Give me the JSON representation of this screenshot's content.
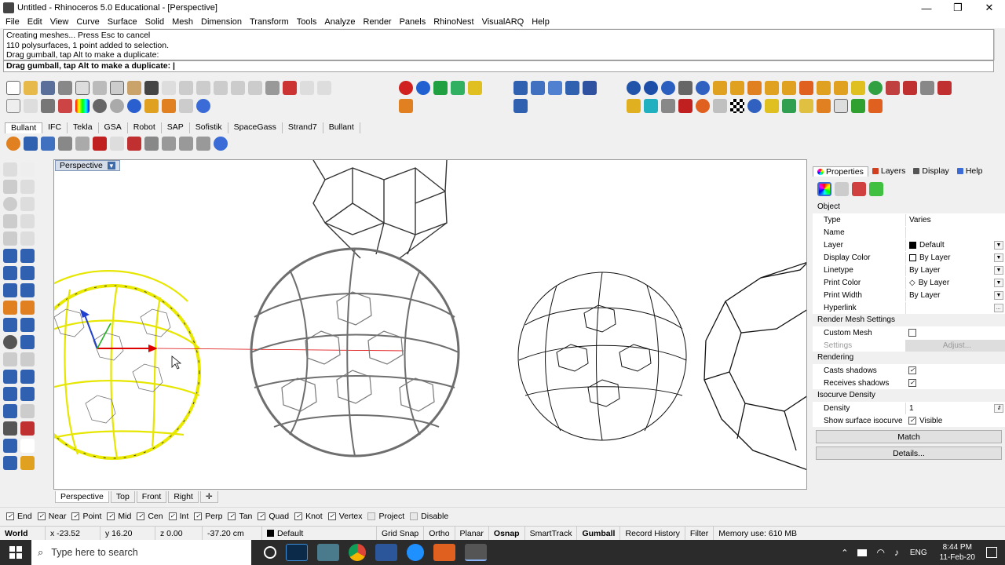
{
  "window": {
    "title": "Untitled - Rhinoceros 5.0 Educational - [Perspective]",
    "min": "—",
    "max": "❐",
    "close": "✕"
  },
  "menu": [
    "File",
    "Edit",
    "View",
    "Curve",
    "Surface",
    "Solid",
    "Mesh",
    "Dimension",
    "Transform",
    "Tools",
    "Analyze",
    "Render",
    "Panels",
    "RhinoNest",
    "VisualARQ",
    "Help"
  ],
  "command": {
    "history": [
      "Creating meshes... Press Esc to cancel",
      "110 polysurfaces, 1 point added to selection.",
      "Drag gumball, tap Alt to make a duplicate:"
    ],
    "prompt": "Drag gumball, tap Alt to make a duplicate:"
  },
  "toolbar_tabs": [
    "Bullant",
    "IFC",
    "Tekla",
    "GSA",
    "Robot",
    "SAP",
    "Sofistik",
    "SpaceGass",
    "Strand7",
    "Bullant"
  ],
  "viewport": {
    "label": "Perspective",
    "tabs": [
      "Perspective",
      "Top",
      "Front",
      "Right"
    ],
    "add": "✛"
  },
  "panel": {
    "tabs": [
      "Properties",
      "Layers",
      "Display",
      "Help"
    ],
    "sections": {
      "object": "Object",
      "render_mesh": "Render Mesh Settings",
      "rendering": "Rendering",
      "isocurve": "Isocurve Density"
    },
    "rows": [
      {
        "k": "Type",
        "v": "Varies"
      },
      {
        "k": "Name",
        "v": ""
      },
      {
        "k": "Layer",
        "v": "Default"
      },
      {
        "k": "Display Color",
        "v": "By Layer"
      },
      {
        "k": "Linetype",
        "v": "By Layer"
      },
      {
        "k": "Print Color",
        "v": "By Layer"
      },
      {
        "k": "Print Width",
        "v": "By Layer"
      },
      {
        "k": "Hyperlink",
        "v": ""
      }
    ],
    "custom_mesh": "Custom Mesh",
    "settings": "Settings",
    "adjust": "Adjust...",
    "casts": "Casts shadows",
    "receives": "Receives shadows",
    "density": "Density",
    "density_val": "1",
    "show_iso": "Show surface isocurve",
    "visible": "Visible",
    "match": "Match",
    "details": "Details..."
  },
  "osnap": [
    {
      "label": "End",
      "on": true
    },
    {
      "label": "Near",
      "on": true
    },
    {
      "label": "Point",
      "on": true
    },
    {
      "label": "Mid",
      "on": true
    },
    {
      "label": "Cen",
      "on": true
    },
    {
      "label": "Int",
      "on": true
    },
    {
      "label": "Perp",
      "on": true
    },
    {
      "label": "Tan",
      "on": true
    },
    {
      "label": "Quad",
      "on": true
    },
    {
      "label": "Knot",
      "on": true
    },
    {
      "label": "Vertex",
      "on": true
    },
    {
      "label": "Project",
      "on": false
    },
    {
      "label": "Disable",
      "on": false
    }
  ],
  "status": {
    "cplane": "World",
    "x": "x -23.52",
    "y": "y 16.20",
    "z": "z 0.00",
    "dist": "-37.20 cm",
    "layer": "Default",
    "toggles": [
      "Grid Snap",
      "Ortho",
      "Planar",
      "Osnap",
      "SmartTrack",
      "Gumball",
      "Record History",
      "Filter"
    ],
    "memory": "Memory use: 610 MB"
  },
  "taskbar": {
    "search": "Type here to search",
    "lang": "ENG",
    "time": "8:44 PM",
    "date": "11-Feb-20"
  },
  "colors": {
    "accent": "#3f6aa8",
    "yellow_mesh": "#e8e800",
    "grey_mesh": "#6e6e6e"
  }
}
